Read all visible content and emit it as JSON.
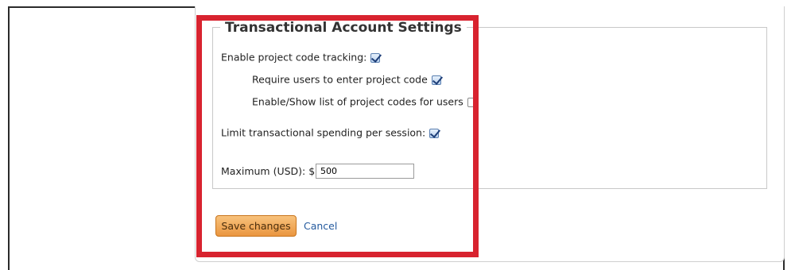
{
  "settings": {
    "legend": "Transactional Account Settings",
    "options": [
      {
        "label": "Enable project code tracking:",
        "checked": true
      },
      {
        "label": "Require users to enter project code",
        "checked": true
      },
      {
        "label": "Enable/Show list of project codes for users",
        "checked": false
      },
      {
        "label": "Limit transactional spending per session:",
        "checked": true
      }
    ],
    "maximum": {
      "label": "Maximum (USD): $",
      "value": "500"
    }
  },
  "actions": {
    "save_label": "Save changes",
    "cancel_label": "Cancel"
  },
  "colors": {
    "highlight": "#d8232f",
    "save_button": "#ea9640",
    "link": "#245a9e"
  }
}
